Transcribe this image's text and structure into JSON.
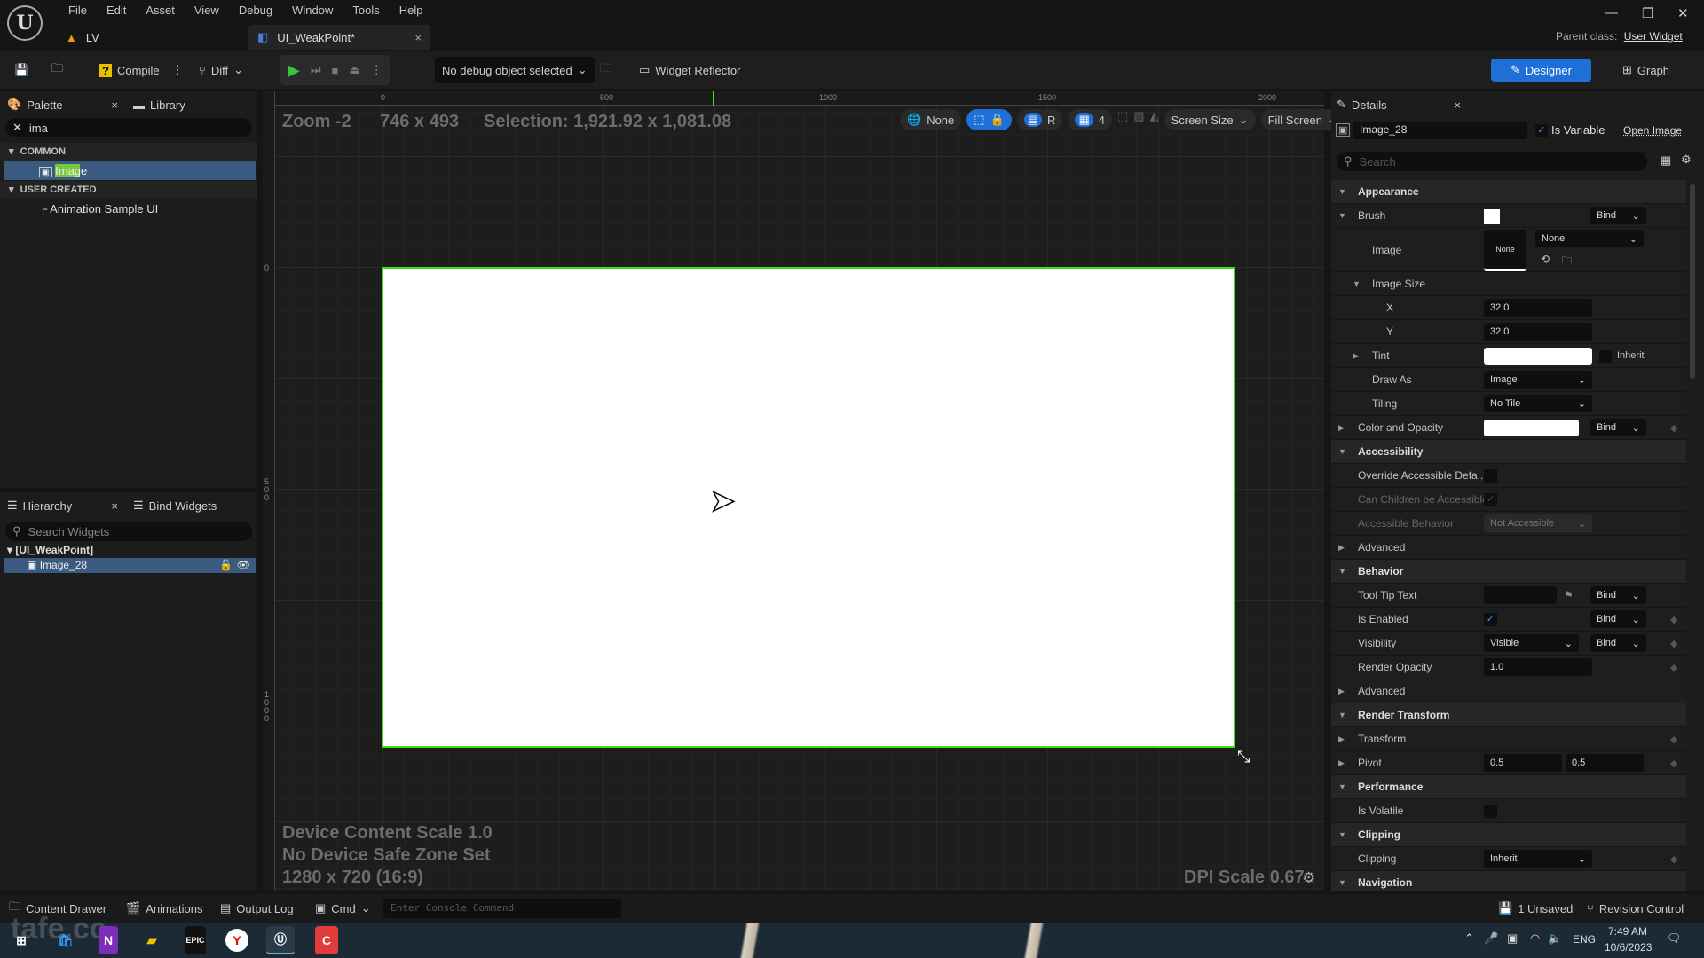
{
  "menu": {
    "items": [
      "File",
      "Edit",
      "Asset",
      "View",
      "Debug",
      "Window",
      "Tools",
      "Help"
    ]
  },
  "tabs": [
    {
      "label": "LV"
    },
    {
      "label": "UI_WeakPoint*"
    }
  ],
  "parent_class": {
    "label": "Parent class:",
    "value": "User Widget"
  },
  "modes": {
    "designer": "Designer",
    "graph": "Graph"
  },
  "toolbar": {
    "compile": "Compile",
    "diff": "Diff",
    "debug_object": "No debug object selected",
    "widget_reflector": "Widget Reflector"
  },
  "palette": {
    "tab": "Palette",
    "library_tab": "Library",
    "search_value": "ima",
    "categories": [
      {
        "label": "COMMON",
        "items": [
          "Image"
        ]
      },
      {
        "label": "USER CREATED",
        "items": [
          "Animation Sample UI"
        ]
      }
    ]
  },
  "hierarchy": {
    "tab": "Hierarchy",
    "bind_tab": "Bind Widgets",
    "search_placeholder": "Search Widgets",
    "root": "[UI_WeakPoint]",
    "child": "Image_28"
  },
  "viewport": {
    "zoom": "Zoom -2",
    "size": "746 x 493",
    "selection": "Selection: 1,921.92 x 1,081.08",
    "ruler_top": [
      "0",
      "500",
      "1000",
      "1500",
      "2000"
    ],
    "ruler_left": [
      "0",
      "500",
      "1000"
    ],
    "toolbar": {
      "localization": "None",
      "refresh": "R",
      "grid": "4",
      "screen_size": "Screen Size",
      "fill_screen": "Fill Screen"
    },
    "device_scale": "Device Content Scale 1.0",
    "safe_zone": "No Device Safe Zone Set",
    "resolution": "1280 x 720 (16:9)",
    "dpi": "DPI Scale 0.67",
    "canvas_color": "#ffffff",
    "selection_color": "#3cde14"
  },
  "details": {
    "tab": "Details",
    "widget_name": "Image_28",
    "is_variable": "Is Variable",
    "open_image": "Open Image",
    "search_placeholder": "Search",
    "rows": [
      {
        "type": "section",
        "label": "Appearance"
      },
      {
        "type": "prop",
        "label": "Brush",
        "exp": "open",
        "lv": 0,
        "swatch": true,
        "bind": "Bind"
      },
      {
        "type": "image",
        "label": "Image",
        "lv": 1,
        "thumb": "None",
        "select": "None"
      },
      {
        "type": "prop",
        "label": "Image Size",
        "exp": "open",
        "lv": 1
      },
      {
        "type": "prop",
        "label": "X",
        "lv": 2,
        "input": "32.0"
      },
      {
        "type": "prop",
        "label": "Y",
        "lv": 2,
        "input": "32.0"
      },
      {
        "type": "prop",
        "label": "Tint",
        "exp": "closed",
        "lv": 1,
        "color": true,
        "check_label": "Inherit"
      },
      {
        "type": "prop",
        "label": "Draw As",
        "lv": 1,
        "select": "Image"
      },
      {
        "type": "prop",
        "label": "Tiling",
        "lv": 1,
        "select": "No Tile"
      },
      {
        "type": "prop",
        "label": "Color and Opacity",
        "exp": "closed",
        "lv": 0,
        "color": true,
        "bind": "Bind"
      },
      {
        "type": "section",
        "label": "Accessibility"
      },
      {
        "type": "prop",
        "label": "Override Accessible Defa...",
        "lv": 0,
        "checkbox": false
      },
      {
        "type": "prop",
        "label": "Can Children be Accessible",
        "lv": 0,
        "checkbox": true,
        "disabled": true
      },
      {
        "type": "prop",
        "label": "Accessible Behavior",
        "lv": 0,
        "select": "Not Accessible",
        "disabled": true
      },
      {
        "type": "prop",
        "label": "Advanced",
        "exp": "closed",
        "lv": 0
      },
      {
        "type": "section",
        "label": "Behavior"
      },
      {
        "type": "prop",
        "label": "Tool Tip Text",
        "lv": 0,
        "text": "",
        "bind": "Bind"
      },
      {
        "type": "prop",
        "label": "Is Enabled",
        "lv": 0,
        "checkbox": true,
        "bind": "Bind"
      },
      {
        "type": "prop",
        "label": "Visibility",
        "lv": 0,
        "select": "Visible",
        "bind": "Bind"
      },
      {
        "type": "prop",
        "label": "Render Opacity",
        "lv": 0,
        "input": "1.0"
      },
      {
        "type": "prop",
        "label": "Advanced",
        "exp": "closed",
        "lv": 0
      },
      {
        "type": "section",
        "label": "Render Transform"
      },
      {
        "type": "prop",
        "label": "Transform",
        "exp": "closed",
        "lv": 0
      },
      {
        "type": "prop",
        "label": "Pivot",
        "exp": "closed",
        "lv": 0,
        "pair": [
          "0.5",
          "0.5"
        ]
      },
      {
        "type": "section",
        "label": "Performance"
      },
      {
        "type": "prop",
        "label": "Is Volatile",
        "lv": 0,
        "checkbox": false
      },
      {
        "type": "section",
        "label": "Clipping"
      },
      {
        "type": "prop",
        "label": "Clipping",
        "lv": 0,
        "select": "Inherit"
      },
      {
        "type": "section",
        "label": "Navigation"
      }
    ]
  },
  "bottom": {
    "content_drawer": "Content Drawer",
    "animations": "Animations",
    "output_log": "Output Log",
    "cmd": "Cmd",
    "console_placeholder": "Enter Console Command",
    "unsaved": "1 Unsaved",
    "revision": "Revision Control"
  },
  "taskbar": {
    "lang": "ENG",
    "time": "7:49 AM",
    "date": "10/6/2023",
    "watermark": "tafe.cc"
  },
  "colors": {
    "accent": "#1f6fd8",
    "selection": "#3cde14",
    "highlight": "#7ac943"
  }
}
